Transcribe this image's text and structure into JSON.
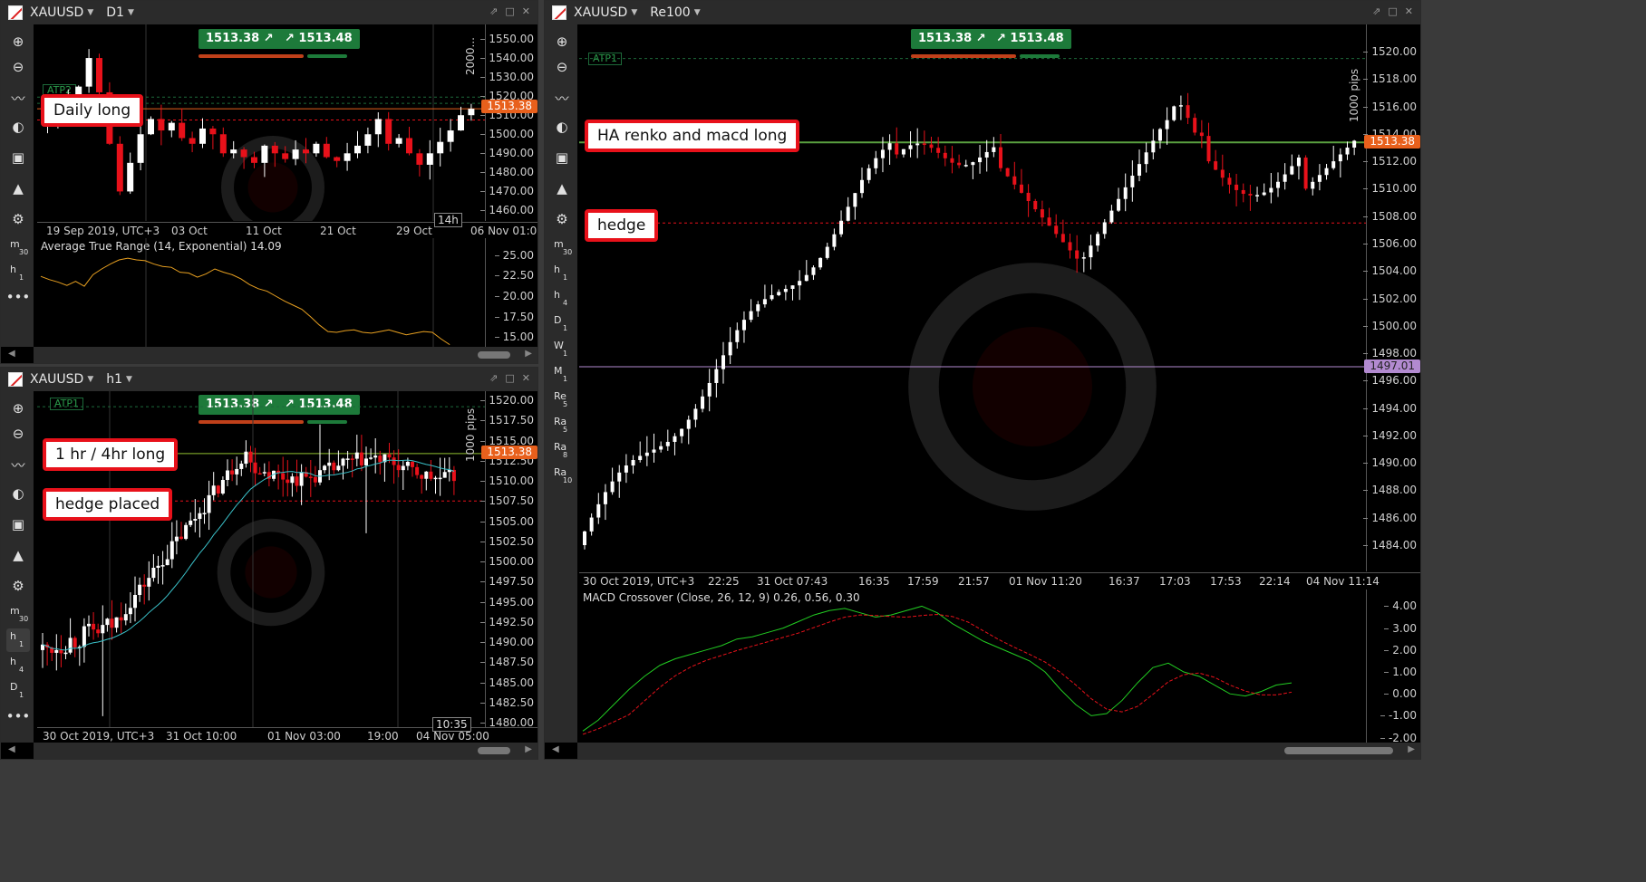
{
  "panels": {
    "d1": {
      "symbol": "XAUUSD",
      "timeframe": "D1",
      "price_ticks": [
        "1550.00",
        "1540.00",
        "1530.00",
        "1520.00",
        "1510.00",
        "1500.00",
        "1490.00",
        "1480.00",
        "1470.00",
        "1460.00"
      ],
      "time_labels": [
        "19 Sep 2019, UTC+3",
        "03 Oct",
        "11 Oct",
        "21 Oct",
        "29 Oct",
        "06 Nov 01:00"
      ],
      "bid": "1513.38",
      "ask": "1513.48",
      "current_price": "1513.38",
      "atp_label": "ATP2",
      "pips_label": "2000...",
      "countdown": "14h",
      "annotation": "Daily long",
      "indicator": {
        "label": "Average True Range (14, Exponential) 14.09",
        "ticks": [
          "25.00",
          "22.50",
          "20.00",
          "17.50",
          "15.00"
        ],
        "values": [
          22.4,
          22.0,
          21.7,
          21.3,
          21.8,
          21.2,
          22.6,
          23.3,
          23.9,
          24.4,
          24.6,
          24.4,
          24.3,
          23.9,
          23.6,
          23.5,
          22.9,
          22.8,
          22.3,
          22.7,
          23.3,
          22.9,
          22.6,
          22.1,
          21.4,
          20.9,
          20.6,
          20.0,
          19.4,
          18.9,
          18.4,
          17.5,
          16.5,
          15.7,
          15.6,
          15.8,
          15.9,
          15.6,
          15.5,
          15.7,
          15.9,
          15.6,
          15.3,
          15.5,
          15.7,
          15.6,
          14.8,
          14.1
        ]
      }
    },
    "h1": {
      "symbol": "XAUUSD",
      "timeframe": "h1",
      "price_ticks": [
        "1520.00",
        "1517.50",
        "1515.00",
        "1512.50",
        "1510.00",
        "1507.50",
        "1505.00",
        "1502.50",
        "1500.00",
        "1497.50",
        "1495.00",
        "1492.50",
        "1490.00",
        "1487.50",
        "1485.00",
        "1482.50",
        "1480.00"
      ],
      "time_labels": [
        "30 Oct 2019, UTC+3",
        "31 Oct 10:00",
        "01 Nov 03:00",
        "19:00",
        "04 Nov 05:00"
      ],
      "bid": "1513.38",
      "ask": "1513.48",
      "current_price": "1513.38",
      "atp_label": "ATP1",
      "pips_label": "1000 pips",
      "countdown": "10:35",
      "annotations": [
        "1 hr / 4hr long",
        "hedge placed"
      ]
    },
    "re100": {
      "symbol": "XAUUSD",
      "timeframe": "Re100",
      "price_ticks": [
        "1520.00",
        "1518.00",
        "1516.00",
        "1514.00",
        "1512.00",
        "1510.00",
        "1508.00",
        "1506.00",
        "1504.00",
        "1502.00",
        "1500.00",
        "1498.00",
        "1496.00",
        "1494.00",
        "1492.00",
        "1490.00",
        "1488.00",
        "1486.00",
        "1484.00"
      ],
      "time_labels": [
        "30 Oct 2019, UTC+3",
        "22:25",
        "31 Oct 07:43",
        "16:35",
        "17:59",
        "21:57",
        "01 Nov 11:20",
        "16:37",
        "17:03",
        "17:53",
        "22:14",
        "04 Nov 11:14"
      ],
      "bid": "1513.38",
      "ask": "1513.48",
      "current_price": "1513.38",
      "crosshair_price": "1497.01",
      "atp_label": "ATP1",
      "pips_label": "1000 pips",
      "annotations": [
        "HA renko and macd long",
        "hedge"
      ],
      "indicator": {
        "label": "MACD Crossover (Close, 26, 12, 9) 0.26, 0.56, 0.30",
        "ticks": [
          "4.00",
          "3.00",
          "2.00",
          "1.00",
          "0.00",
          "-1.00",
          "-2.00"
        ]
      }
    }
  },
  "timeframe_buttons": [
    "m30",
    "h1",
    "h4",
    "D1",
    "W1",
    "M1",
    "Re5",
    "Ra5",
    "Ra8",
    "Ra10"
  ],
  "colors": {
    "bull": "#ffffff",
    "bear": "#e8111a",
    "accent": "#e8601c",
    "buy": "#1d7a3a",
    "atr_line": "#e8a020",
    "macd": "#22cc22",
    "signal": "#e8111a"
  }
}
